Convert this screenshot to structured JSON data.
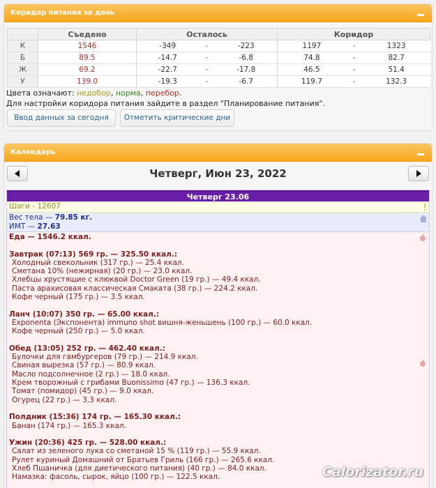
{
  "corridor_panel": {
    "title": "Коридор питания за день",
    "headers": [
      "",
      "Съедено",
      "Осталось",
      "Коридор"
    ],
    "rows": [
      {
        "label": "К",
        "eaten": "1546",
        "left_min": "-349",
        "left_max": "-223",
        "corr_min": "1197",
        "corr_max": "1323"
      },
      {
        "label": "Б",
        "eaten": "89.5",
        "left_min": "-14.7",
        "left_max": "-6.8",
        "corr_min": "74.8",
        "corr_max": "82.7"
      },
      {
        "label": "Ж",
        "eaten": "69.2",
        "left_min": "-22.7",
        "left_max": "-17.8",
        "corr_min": "46.5",
        "corr_max": "51.4"
      },
      {
        "label": "У",
        "eaten": "139.0",
        "left_min": "-19.3",
        "left_max": "-6.7",
        "corr_min": "119.7",
        "corr_max": "132.3"
      }
    ],
    "dash": "-",
    "legend": {
      "prefix": "Цвета означают: ",
      "low": "недобор",
      "comma1": ", ",
      "norm": "норма",
      "comma2": ", ",
      "over": "перебор",
      "end": "."
    },
    "hint": "Для настройки коридора питания зайдите в раздел \"Планирование питания\".",
    "enter_button": "Ввод данных за сегодня",
    "critical_button": "Отметить критические дни"
  },
  "calendar_panel": {
    "title": "Календарь",
    "date_title": "Четверг, Июн 23, 2022",
    "day_bar": "Четверг 23.06",
    "steps": "Шаги - 12607",
    "weight": {
      "label": "Вес тела — ",
      "value": "79.85 кг."
    },
    "bmi": {
      "label": "ИМТ — ",
      "value": "27.63"
    },
    "food_total": "Еда — 1546.2 ккал.",
    "meals": [
      {
        "title": "Завтрак (07:13) 569 гр. — 325.50 ккал.:",
        "items": [
          "Холодный свекольник (317 гр.) — 25.4 ккал.",
          "Сметана 10% (нежирная) (20 гр.) — 23.0 ккал.",
          "Хлебцы хрустящие с клюквой Doctor Green (19 гр.) — 49.4 ккал.",
          "Паста арахисовая классическая Смаката (38 гр.) — 224.2 ккал.",
          "Кофе черный (175 гр.) — 3.5 ккал."
        ]
      },
      {
        "title": "Ланч (10:07) 350 гр. — 65.00 ккал.:",
        "items": [
          "Exponenta (Экспонента) immuno shot вишня-женьшень (100 гр.) — 60.0 ккал.",
          "Кофе черный (250 гр.) — 5.0 ккал."
        ]
      },
      {
        "title": "Обед (13:05) 252 гр. — 462.40 ккал.:",
        "items": [
          "Булочки для гамбургеров (79 гр.) — 214.9 ккал.",
          "Свиная вырезка (57 гр.) — 80.9 ккал.",
          "Масло подсолнечное (2 гр.) — 18.0 ккал.",
          "Крем творожный с грибами Buonissimo (47 гр.) — 136.3 ккал.",
          "Томат (помидор) (45 гр.) — 9.0 ккал.",
          "Огурец (22 гр.) — 3.3 ккал."
        ]
      },
      {
        "title": "Полдник (15:36) 174 гр. — 165.30 ккал.:",
        "items": [
          "Банан (174 гр.) — 165.3 ккал."
        ]
      },
      {
        "title": "Ужин (20:36) 425 гр. — 528.00 ккал.:",
        "items": [
          "Салат из зеленого лука со сметаной 15 % (119 гр.) — 55.9 ккал.",
          "Рулет куриный Домашний от Братьев Гриль (166 гр.) — 265.6 ккал.",
          "Хлеб Пшаничка (для диетического питания) (40 гр.) — 84.0 ккал.",
          "Намазка: фасоль, сырок, яйцо (100 гр.) — 122.5 ккал."
        ]
      }
    ]
  },
  "watermark": "Calorizator.ru",
  "colors": {
    "header_orange": "#f6a51c",
    "day_bar_purple": "#6a1fa8",
    "eaten_red": "#b2302c",
    "link_blue": "#2a6496"
  },
  "icons": {
    "collapse": "minus-icon",
    "prev": "arrow-left-icon",
    "next": "arrow-right-icon",
    "steps": "exclamation-icon",
    "weight": "scale-icon",
    "food": "apple-icon"
  }
}
